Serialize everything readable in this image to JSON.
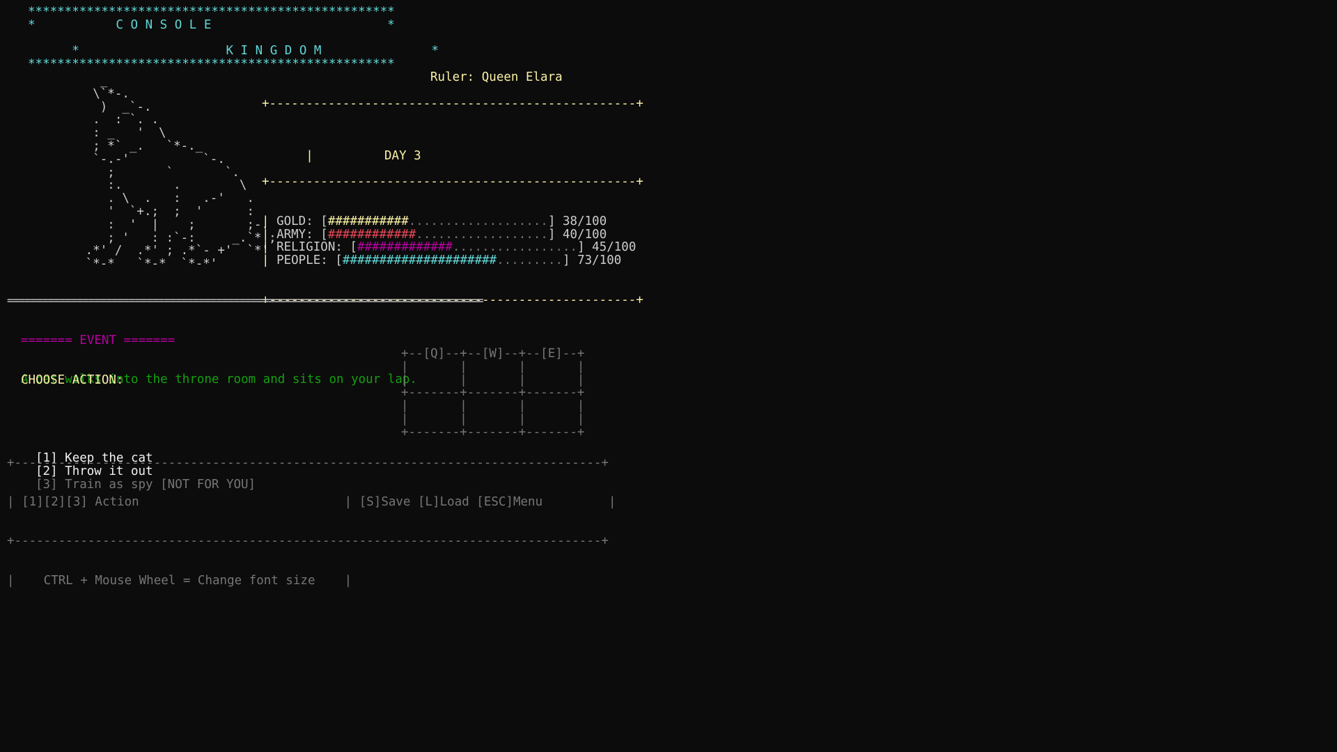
{
  "header": {
    "stars_line": "**************************************************",
    "title_line1": "*           C O N S O L E                        *",
    "title_line2": "*                    K I N G D O M               *",
    "ruler_label": "Ruler: Queen Elara"
  },
  "art": [
    "       _",
    "      \\`*-.",
    "       )  _`-.",
    "      .  : `. .",
    "      : _   '  \\",
    "      ; *` _.   `*-._",
    "      `-.-'          `-.",
    "        ;       `       `.",
    "        :.       .        \\",
    "        . \\  .   :   .-'   .",
    "        '  `+.;  ;  '      :",
    "        :  '  |    ;       ;-.",
    "        ; '   : :`-:     _.`* ;",
    "     .*' /  .*' ; .*`- +'  `*'",
    "     `*-*   `*-*  `*-*'"
  ],
  "stats": {
    "border": "+--------------------------------------------------+",
    "day_label": "DAY 3",
    "rows": [
      {
        "label": "GOLD:",
        "bar_fill": "###########",
        "bar_empty": "...................",
        "value": "38/100",
        "color": "#f9f1a5",
        "level": 0.38
      },
      {
        "label": "ARMY:",
        "bar_fill": "############",
        "bar_empty": "..................",
        "value": "40/100",
        "color": "#e74856",
        "level": 0.4
      },
      {
        "label": "RELIGION:",
        "bar_fill": "#############",
        "bar_empty": ".................",
        "value": "45/100",
        "color": "#b4009e",
        "level": 0.45
      },
      {
        "label": "PEOPLE:",
        "bar_fill": "#####################",
        "bar_empty": ".........",
        "value": "73/100",
        "color": "#61d6d6",
        "level": 0.73
      }
    ]
  },
  "divider": "==================================================================================",
  "event": {
    "heading": "======= EVENT =======",
    "text": "A cat walks into the throne room and sits on your lap."
  },
  "actions": {
    "heading": "CHOOSE ACTION:",
    "options": [
      {
        "key": "[1]",
        "label": "Keep the cat",
        "enabled": true
      },
      {
        "key": "[2]",
        "label": "Throw it out",
        "enabled": true
      },
      {
        "key": "[3]",
        "label": "Train as spy [NOT FOR YOU]",
        "enabled": false
      }
    ]
  },
  "keypad": [
    "+--[Q]--+--[W]--+--[E]--+",
    "|       |       |       |",
    "|       |       |       |",
    "+-------+-------+-------+",
    "|       |       |       |",
    "|       |       |       |",
    "+-------+-------+-------+"
  ],
  "footer": {
    "border": "+--------------------------------------------------------------------------------+",
    "action_hint": "| [1][2][3] Action                            | [S]Save [L]Load [ESC]Menu         |",
    "font_hint": "|    CTRL + Mouse Wheel = Change font size    |"
  },
  "colors": {
    "background": "#0c0c0c",
    "cyan": "#61d6d6",
    "yellow": "#f9f1a5",
    "red": "#e74856",
    "magenta": "#b4009e",
    "green": "#13a10e",
    "gray": "#767676"
  }
}
